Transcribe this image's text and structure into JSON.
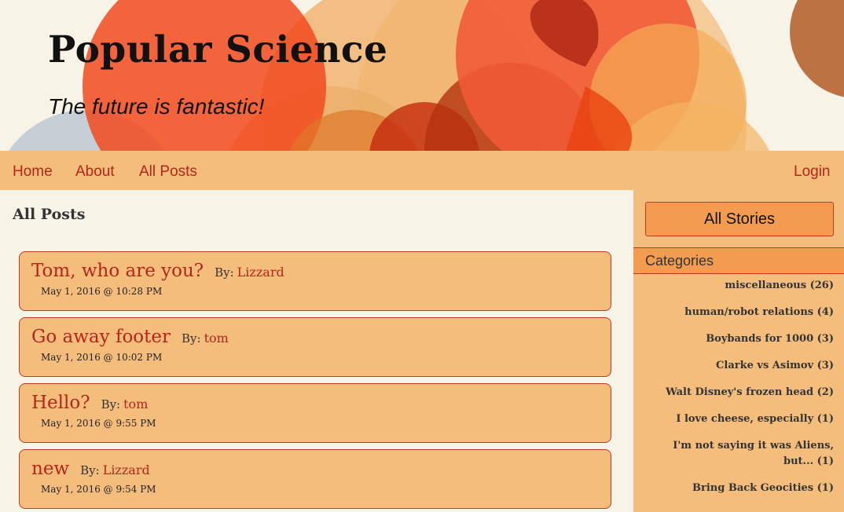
{
  "site": {
    "title": "Popular Science",
    "tagline": "The future is fantastic!"
  },
  "nav": {
    "home": "Home",
    "about": "About",
    "all_posts": "All Posts",
    "login": "Login"
  },
  "main": {
    "heading": "All Posts",
    "by_label": "By:",
    "posts": [
      {
        "title": "Tom, who are you?",
        "author": "Lizzard",
        "date": "May 1, 2016 @ 10:28 PM"
      },
      {
        "title": "Go away footer",
        "author": "tom",
        "date": "May 1, 2016 @ 10:02 PM"
      },
      {
        "title": "Hello?",
        "author": "tom",
        "date": "May 1, 2016 @ 9:55 PM"
      },
      {
        "title": "new",
        "author": "Lizzard",
        "date": "May 1, 2016 @ 9:54 PM"
      }
    ]
  },
  "sidebar": {
    "all_stories": "All Stories",
    "categories_heading": "Categories",
    "categories": [
      "miscellaneous (26)",
      "human/robot relations (4)",
      "Boybands for 1000 (3)",
      "Clarke vs Asimov (3)",
      "Walt Disney's frozen head (2)",
      "I love cheese, especially (1)",
      "I'm not saying it was Aliens, but... (1)",
      "Bring Back Geocities (1)"
    ]
  },
  "colors": {
    "accent": "#b3261a",
    "nav_bg": "#f5bd7c",
    "page_bg": "#f7f3e7",
    "button_bg": "#f39c4f"
  }
}
